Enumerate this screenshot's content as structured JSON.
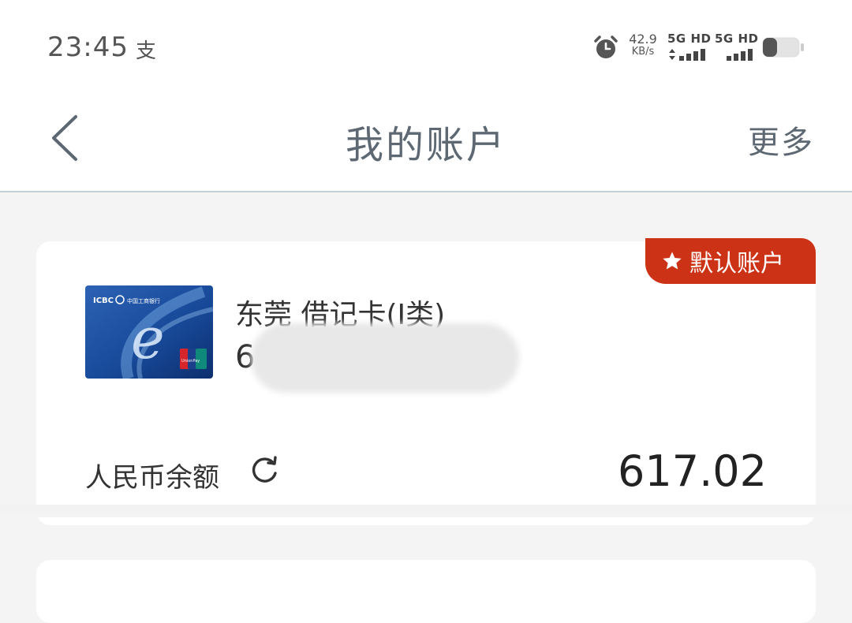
{
  "status_bar": {
    "time": "23:45",
    "alipay_glyph": "支",
    "net_speed_value": "42.9",
    "net_speed_unit": "KB/s",
    "sim1_label": "5G HD",
    "sim2_label": "5G HD",
    "icons": [
      "alarm-icon",
      "signal-icon",
      "battery-icon"
    ]
  },
  "nav": {
    "title": "我的账户",
    "more_label": "更多",
    "back_icon": "chevron-left-icon"
  },
  "account": {
    "default_badge": "默认账户",
    "card_name": "东莞 借记卡(Ⅰ类)",
    "card_number_visible": "6",
    "card_image_brand": "ICBC",
    "card_image_bank": "中国工商银行",
    "card_image_unionpay": "UnionPay",
    "balance_label": "人民币余额",
    "balance_value": "617.02"
  },
  "colors": {
    "accent_red": "#cc3216",
    "nav_text": "#5d6873",
    "page_bg": "#f4f4f4"
  }
}
